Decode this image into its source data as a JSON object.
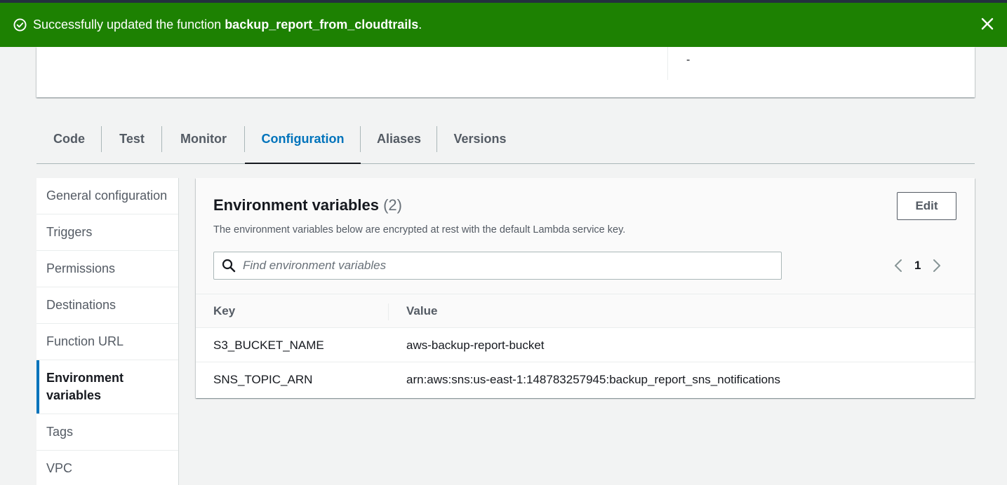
{
  "flash": {
    "message_prefix": "Successfully updated the function ",
    "function_name": "backup_report_from_cloudtrails",
    "message_suffix": ".",
    "color": "#1d8102"
  },
  "summary": {
    "value": "-"
  },
  "tabs": [
    {
      "label": "Code",
      "active": false
    },
    {
      "label": "Test",
      "active": false
    },
    {
      "label": "Monitor",
      "active": false
    },
    {
      "label": "Configuration",
      "active": true
    },
    {
      "label": "Aliases",
      "active": false
    },
    {
      "label": "Versions",
      "active": false
    }
  ],
  "sidenav": {
    "items": [
      {
        "label": "General configuration"
      },
      {
        "label": "Triggers"
      },
      {
        "label": "Permissions"
      },
      {
        "label": "Destinations"
      },
      {
        "label": "Function URL"
      },
      {
        "label": "Environment variables",
        "active": true
      },
      {
        "label": "Tags"
      },
      {
        "label": "VPC"
      }
    ]
  },
  "env": {
    "title": "Environment variables",
    "count": "(2)",
    "description": "The environment variables below are encrypted at rest with the default Lambda service key.",
    "edit_label": "Edit",
    "search_placeholder": "Find environment variables",
    "page": "1",
    "columns": [
      "Key",
      "Value"
    ],
    "rows": [
      {
        "key": "S3_BUCKET_NAME",
        "value": "aws-backup-report-bucket"
      },
      {
        "key": "SNS_TOPIC_ARN",
        "value": "arn:aws:sns:us-east-1:148783257945:backup_report_sns_notifications"
      }
    ]
  },
  "icons": {
    "flash_status": "check-circle-icon",
    "flash_close": "close-icon",
    "search": "search-icon",
    "prev": "chevron-left-icon",
    "next": "chevron-right-icon"
  },
  "colors": {
    "accent": "#0073bb",
    "success": "#1d8102"
  }
}
